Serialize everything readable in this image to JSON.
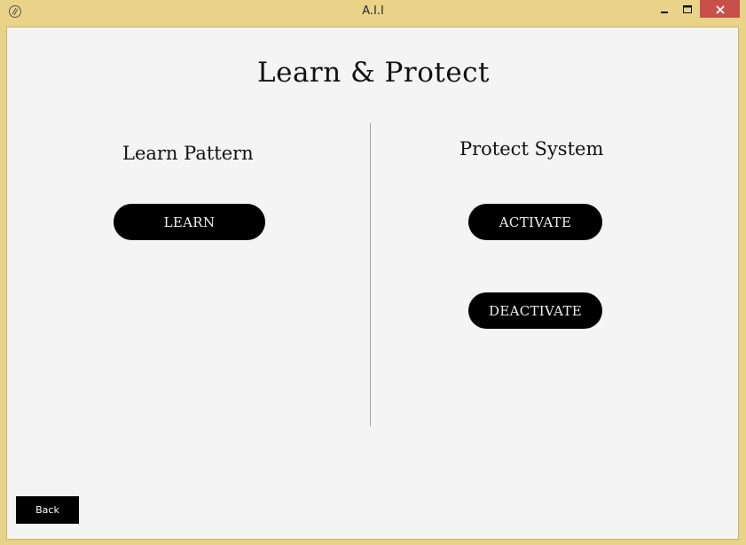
{
  "window": {
    "title": "A.I.I",
    "app_icon": "app-logo-icon",
    "controls": {
      "minimize_icon": "minimize-icon",
      "maximize_icon": "maximize-icon",
      "close_icon": "close-icon",
      "close_color": "#c7504a"
    },
    "frame_color": "#e8d388"
  },
  "main": {
    "title": "Learn & Protect",
    "left_section": {
      "heading": "Learn Pattern",
      "learn_label": "LEARN"
    },
    "right_section": {
      "heading": "Protect System",
      "activate_label": "ACTIVATE",
      "deactivate_label": "DEACTIVATE"
    },
    "back_label": "Back"
  }
}
